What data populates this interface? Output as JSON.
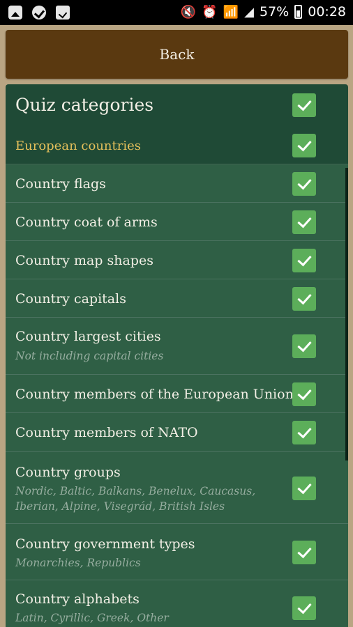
{
  "status_bar": {
    "battery": "57%",
    "time": "00:28",
    "icons": [
      "image-icon",
      "check-circle-icon",
      "bag-icon",
      "mute-icon",
      "alarm-icon",
      "wifi-icon",
      "signal-icon",
      "battery-icon"
    ]
  },
  "back_label": "Back",
  "header": {
    "title": "Quiz categories",
    "checked": true
  },
  "group": {
    "label": "European countries",
    "checked": true
  },
  "categories": [
    {
      "label": "Country flags",
      "sub": "",
      "checked": true
    },
    {
      "label": "Country coat of arms",
      "sub": "",
      "checked": true
    },
    {
      "label": "Country map shapes",
      "sub": "",
      "checked": true
    },
    {
      "label": "Country capitals",
      "sub": "",
      "checked": true
    },
    {
      "label": "Country largest cities",
      "sub": "Not including capital cities",
      "checked": true
    },
    {
      "label": "Country members of the European Union",
      "sub": "",
      "checked": true
    },
    {
      "label": "Country members of NATO",
      "sub": "",
      "checked": true
    },
    {
      "label": "Country groups",
      "sub": "Nordic, Baltic, Balkans, Benelux, Caucasus, Iberian, Alpine, Visegrád, British Isles",
      "checked": true
    },
    {
      "label": "Country government types",
      "sub": "Monarchies, Republics",
      "checked": true
    },
    {
      "label": "Country alphabets",
      "sub": "Latin, Cyrillic, Greek, Other",
      "checked": true
    }
  ],
  "colors": {
    "panel": "#1f4a36",
    "row": "#2f5f45",
    "back_button": "#5a3910",
    "checkbox": "#5cae5a",
    "group_label": "#e5c05b"
  }
}
